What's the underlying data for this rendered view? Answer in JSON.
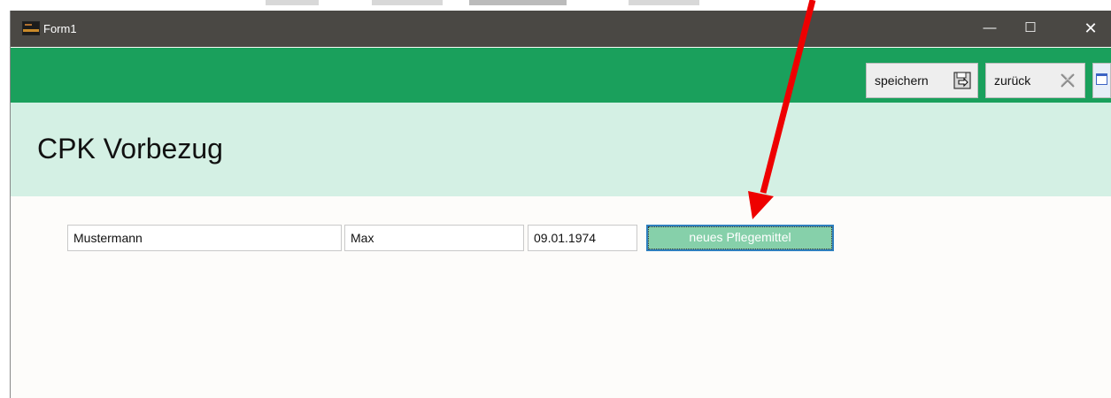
{
  "window": {
    "title": "Form1"
  },
  "window_controls": {
    "minimize": "—",
    "maximize": "☐",
    "close": "✕"
  },
  "toolbar": {
    "save_label": "speichern",
    "back_label": "zurück"
  },
  "header": {
    "title": "CPK Vorbezug"
  },
  "form": {
    "last_name": "Mustermann",
    "first_name": "Max",
    "birth_date": "09.01.1974",
    "new_button_label": "neues Pflegemittel"
  },
  "colors": {
    "titlebar": "#4a4844",
    "toolbar_green": "#1aa05c",
    "header_mint": "#d4f0e4",
    "button_focus": "#2e7fbe",
    "button_fill": "#86d0aa",
    "annotation_arrow": "#ee0000"
  },
  "icons": [
    "app-icon",
    "save-disk-icon",
    "back-cross-icon",
    "window-restore-icon",
    "red-arrow-annotation"
  ]
}
